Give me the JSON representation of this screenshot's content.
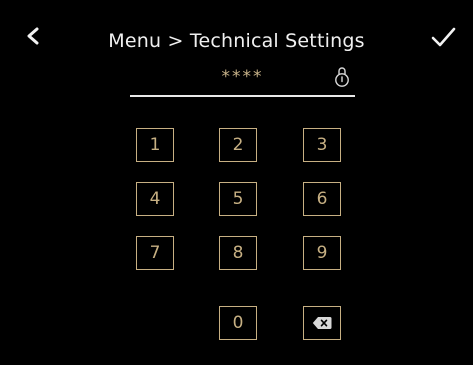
{
  "header": {
    "title": "Menu > Technical Settings"
  },
  "pin": {
    "masked_value": "****"
  },
  "keypad": {
    "keys": [
      "1",
      "2",
      "3",
      "4",
      "5",
      "6",
      "7",
      "8",
      "9",
      "0"
    ]
  },
  "icons": {
    "back": "chevron-left-icon",
    "confirm": "checkmark-icon",
    "lock": "lock-icon",
    "backspace": "backspace-icon"
  },
  "colors": {
    "background": "#000000",
    "accent": "#c7b083",
    "text": "#f0f0f0"
  }
}
